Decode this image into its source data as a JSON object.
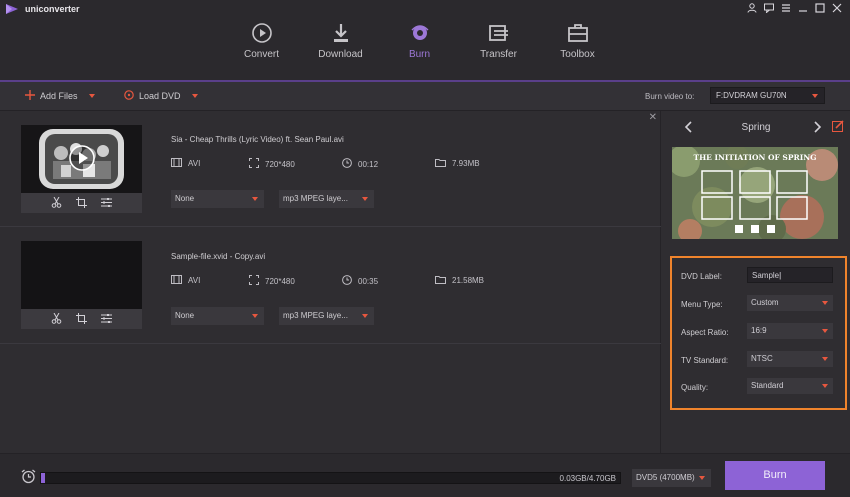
{
  "app": {
    "title": "uniconverter"
  },
  "tabs": [
    {
      "label": "Convert",
      "icon": "convert-icon"
    },
    {
      "label": "Download",
      "icon": "download-icon"
    },
    {
      "label": "Burn",
      "icon": "burn-disc-icon",
      "active": true
    },
    {
      "label": "Transfer",
      "icon": "transfer-icon"
    },
    {
      "label": "Toolbox",
      "icon": "toolbox-icon"
    }
  ],
  "toolbar": {
    "add_files": "Add Files",
    "load_dvd": "Load DVD",
    "burn_to_label": "Burn video to:",
    "burn_to_value": "F:DVDRAM GU70N"
  },
  "files": [
    {
      "name": "Sia - Cheap Thrills (Lyric Video) ft. Sean Paul.avi",
      "format": "AVI",
      "resolution": "720*480",
      "duration": "00:12",
      "size": "7.93MB",
      "subtitle": "None",
      "audio": "mp3 MPEG laye..."
    },
    {
      "name": "Sample-file.xvid - Copy.avi",
      "format": "AVI",
      "resolution": "720*480",
      "duration": "00:35",
      "size": "21.58MB",
      "subtitle": "None",
      "audio": "mp3 MPEG laye..."
    }
  ],
  "theme": {
    "name": "Spring",
    "preview_title": "THE INITIATION OF SPRING"
  },
  "settings": {
    "dvd_label": {
      "label": "DVD Label:",
      "value": "Sample"
    },
    "menu_type": {
      "label": "Menu Type:",
      "value": "Custom"
    },
    "aspect_ratio": {
      "label": "Aspect Ratio:",
      "value": "16:9"
    },
    "tv_standard": {
      "label": "TV Standard:",
      "value": "NTSC"
    },
    "quality": {
      "label": "Quality:",
      "value": "Standard"
    }
  },
  "bottom": {
    "progress_text": "0.03GB/4.70GB",
    "progress_fraction": 0.006,
    "disc_type": "DVD5 (4700MB)",
    "burn_label": "Burn"
  },
  "colors": {
    "accent": "#8d63d6",
    "highlight": "#f0842c",
    "caret": "#e7573f"
  }
}
